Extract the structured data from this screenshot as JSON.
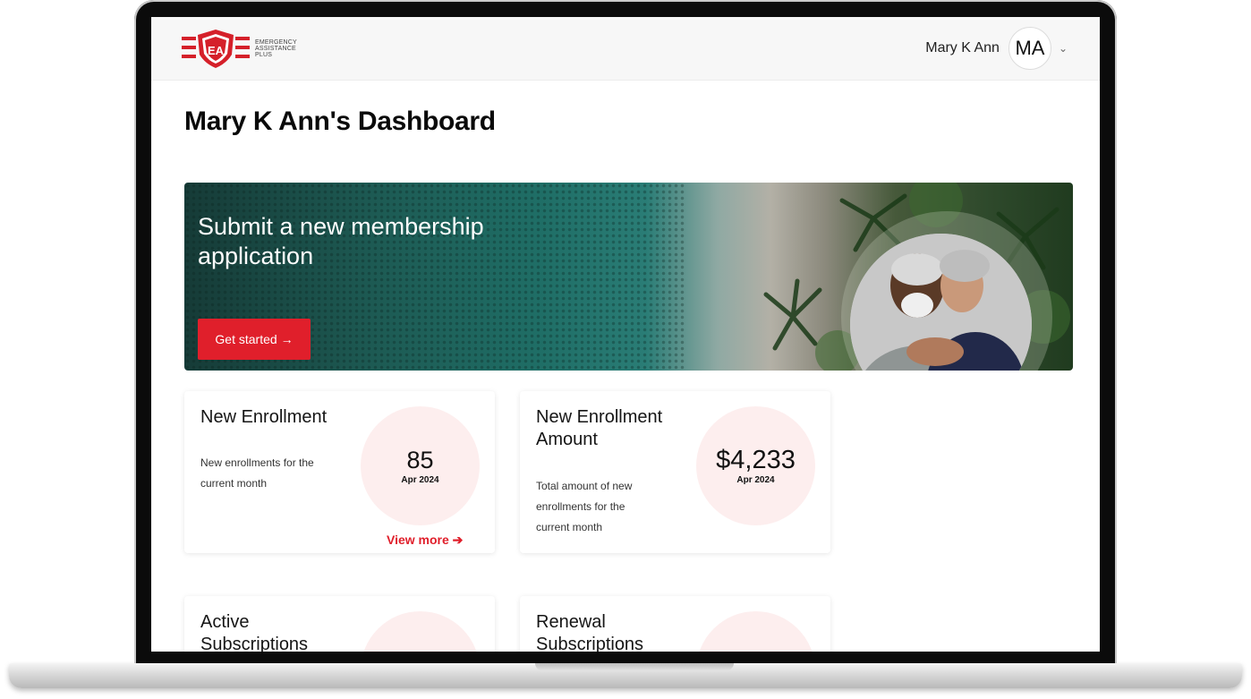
{
  "header": {
    "brand_lines": [
      "EMERGENCY",
      "ASSISTANCE",
      "PLUS"
    ],
    "user_name": "Mary K Ann",
    "avatar_initials": "MA"
  },
  "page": {
    "title": "Mary K Ann's Dashboard"
  },
  "hero": {
    "title": "Submit a new membership application",
    "cta_label": "Get started →"
  },
  "cards": [
    {
      "title": "New Enrollment",
      "description": "New enrollments for the current month",
      "value": "85",
      "period": "Apr 2024",
      "link": "View more ➔"
    },
    {
      "title": "New Enrollment Amount",
      "description": "Total amount of new enrollments for the current month",
      "value": "$4,233",
      "period": "Apr 2024"
    },
    {
      "title": "Active Subscriptions"
    },
    {
      "title": "Renewal Subscriptions"
    }
  ],
  "colors": {
    "accent": "#e01f2b",
    "stat_bg": "#fdeeee"
  }
}
